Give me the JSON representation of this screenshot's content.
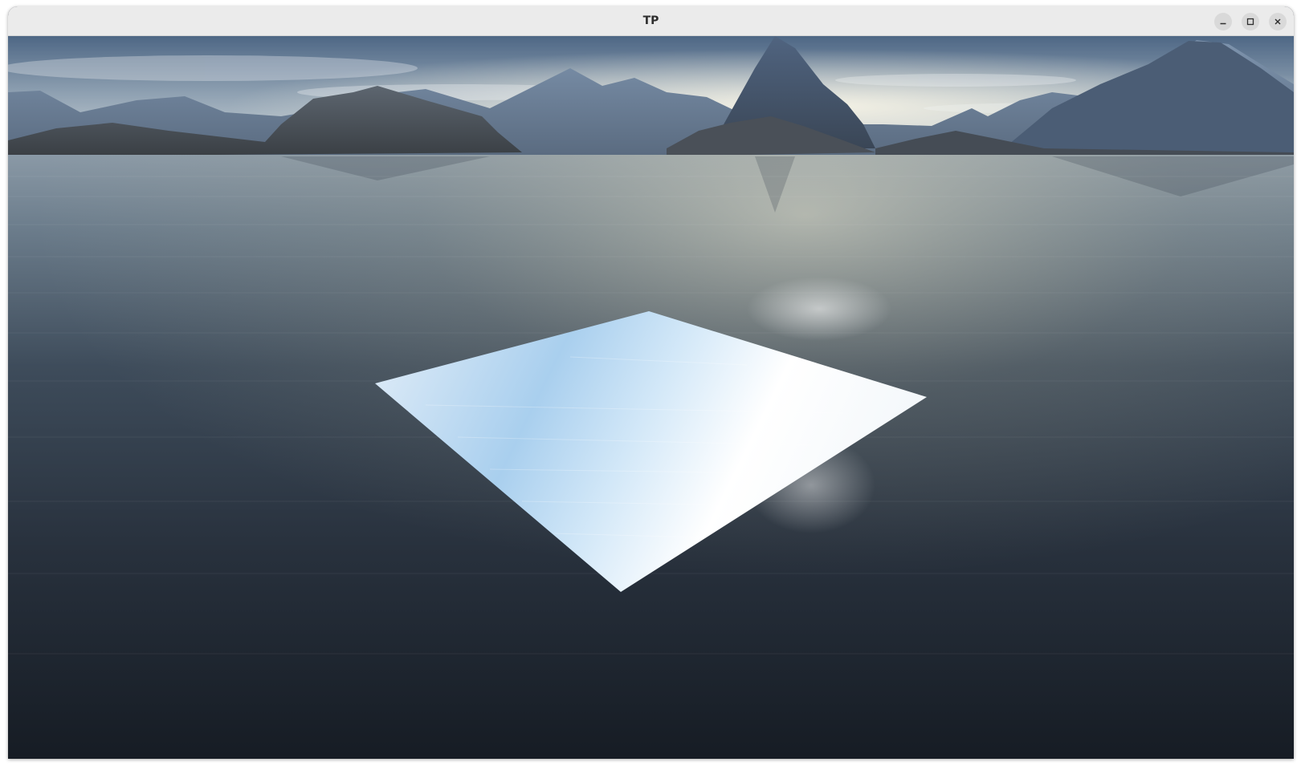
{
  "window": {
    "title": "TP",
    "controls": {
      "minimize_icon": "minimize-icon",
      "maximize_icon": "maximize-icon",
      "close_icon": "close-icon"
    }
  },
  "scene": {
    "colors": {
      "sky_top": "#5a7391",
      "sky_horizon": "#dfe3e0",
      "water_far": "#6f7f8e",
      "water_near": "#1c232c",
      "mountain": "#3c4a5c",
      "mountain_light": "#6f86a3",
      "plane_light": "#f4f9ff",
      "plane_blue": "#9ec8ea"
    }
  }
}
